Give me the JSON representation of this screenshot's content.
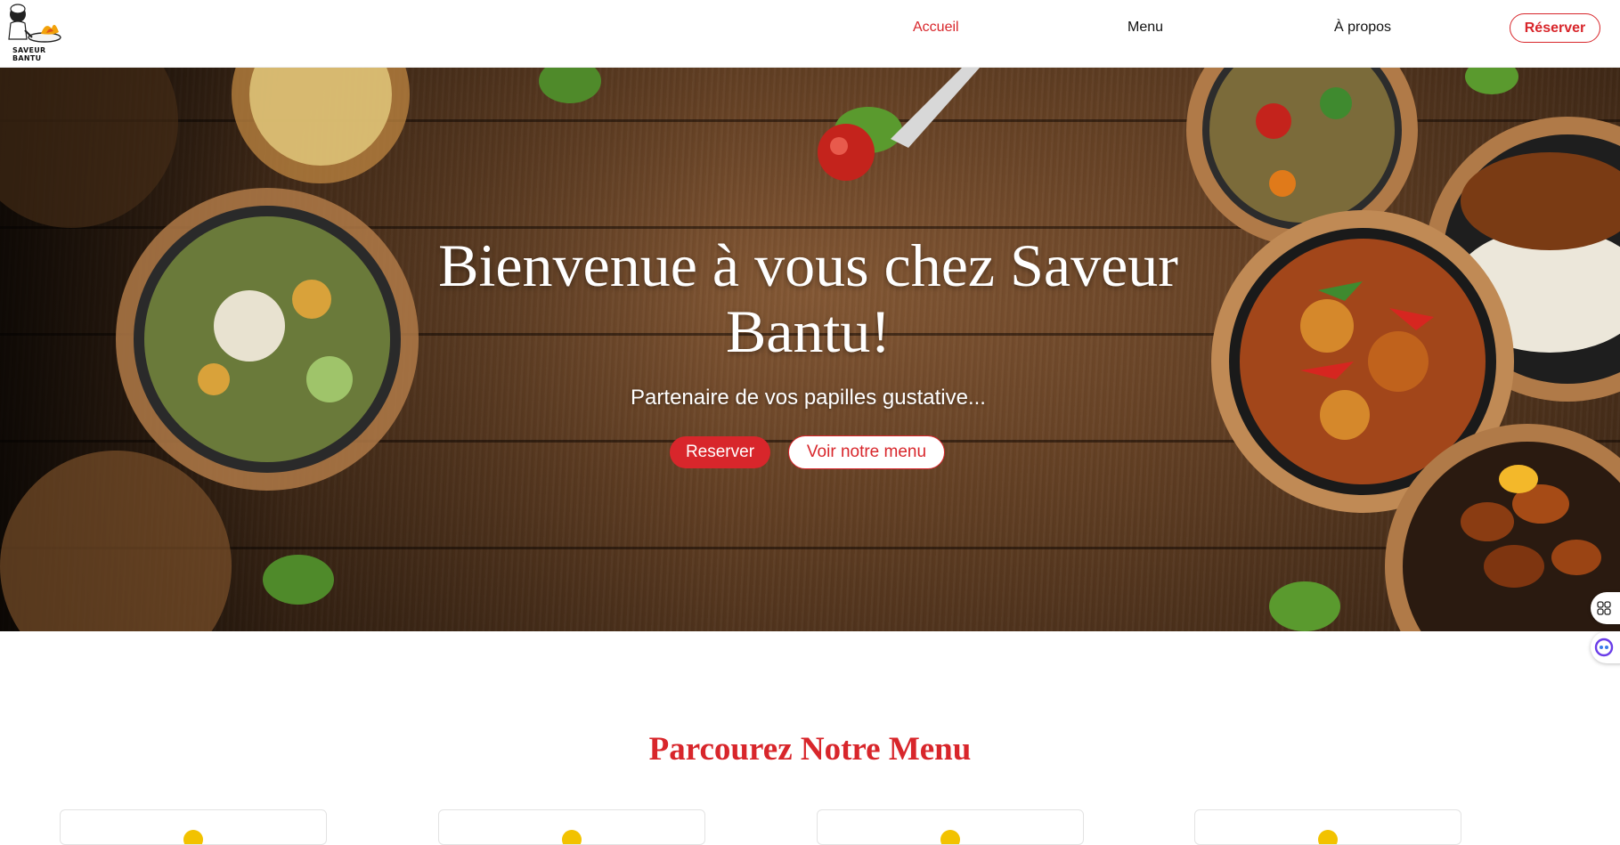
{
  "header": {
    "logo_text": "SAVEUR BANTU",
    "nav": [
      {
        "label": "Accueil",
        "active": true
      },
      {
        "label": "Menu",
        "active": false
      },
      {
        "label": "À propos",
        "active": false
      }
    ],
    "reserve_label": "Réserver"
  },
  "hero": {
    "title": "Bienvenue à vous chez Saveur Bantu!",
    "subtitle": "Partenaire de vos papilles gustative...",
    "primary_button": "Reserver",
    "secondary_button": "Voir notre menu"
  },
  "menu_section": {
    "title": "Parcourez Notre Menu",
    "cards": [
      {},
      {},
      {},
      {}
    ]
  },
  "colors": {
    "accent": "#d8262b",
    "card_icon": "#f2c200"
  },
  "icons": {
    "side_widget_1": "grid-icon",
    "side_widget_2": "chat-assistant-icon"
  }
}
